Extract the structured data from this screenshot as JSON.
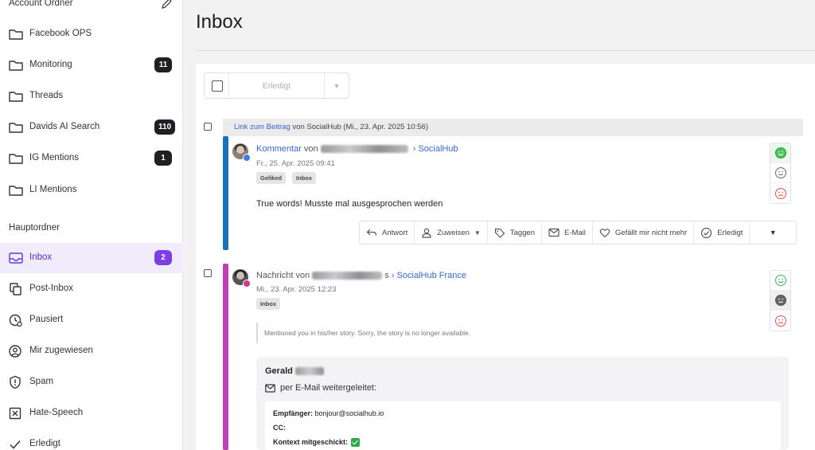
{
  "sidebar": {
    "account_folders_heading": "Account Ordner",
    "account_folders": [
      {
        "label": "Facebook OPS",
        "icon": "folder-icon",
        "count": ""
      },
      {
        "label": "Monitoring",
        "icon": "folder-icon",
        "count": "11"
      },
      {
        "label": "Threads",
        "icon": "folder-icon",
        "count": ""
      },
      {
        "label": "Davids AI Search",
        "icon": "folder-icon",
        "count": "110"
      },
      {
        "label": "IG Mentions",
        "icon": "folder-icon",
        "count": "1"
      },
      {
        "label": "LI Mentions",
        "icon": "folder-icon",
        "count": ""
      }
    ],
    "main_folders_heading": "Hauptordner",
    "main_folders": [
      {
        "label": "Inbox",
        "icon": "inbox-icon",
        "count": "2",
        "active": true
      },
      {
        "label": "Post-Inbox",
        "icon": "copy-icon",
        "count": ""
      },
      {
        "label": "Pausiert",
        "icon": "clock-icon",
        "count": ""
      },
      {
        "label": "Mir zugewiesen",
        "icon": "user-circle-icon",
        "count": ""
      },
      {
        "label": "Spam",
        "icon": "shield-alert-icon",
        "count": ""
      },
      {
        "label": "Hate-Speech",
        "icon": "x-square-icon",
        "count": ""
      },
      {
        "label": "Erledigt",
        "icon": "check-icon",
        "count": ""
      }
    ]
  },
  "main": {
    "title": "Inbox",
    "toolbar": {
      "done_label": "Erledigt"
    }
  },
  "post_bar": {
    "link_text": "Link zum Beitrag",
    "rest_text": "von SocialHub (Mi., 23. Apr. 2025 10:56)"
  },
  "messages": [
    {
      "kind": "Kommentar",
      "from_word": "von",
      "target": "SocialHub",
      "date": "Fr., 25. Apr. 2025 09:41",
      "tags": [
        "Geliked",
        "Inbox"
      ],
      "text": "True words! Musste mal ausgesprochen werden",
      "accent_color": "#1a73b8",
      "network_color": "#3b82d6",
      "sentiment": "positive"
    },
    {
      "kind": "Nachricht",
      "from_word": "von",
      "name_suffix": "s",
      "target": "SocialHub France",
      "date": "Mi., 23. Apr. 2025 12:23",
      "tags": [
        "Inbox"
      ],
      "quote": "Mentioned you in his/her story. Sorry, the story is no longer available.",
      "accent_color": "#c13fb4",
      "network_color": "#d6338a",
      "sentiment": "neutral"
    }
  ],
  "actions": [
    {
      "label": "Antwort",
      "icon": "reply-icon"
    },
    {
      "label": "Zuweisen",
      "icon": "user-icon"
    },
    {
      "label": "Taggen",
      "icon": "tag-icon"
    },
    {
      "label": "E-Mail",
      "icon": "mail-icon"
    },
    {
      "label": "Gefällt mir nicht mehr",
      "icon": "heart-icon"
    },
    {
      "label": "Erledigt",
      "icon": "check-circle-icon"
    }
  ],
  "forward": {
    "name": "Gerald",
    "via": "per E-Mail weitergeleitet:",
    "recipient_label": "Empfänger:",
    "recipient_value": "bonjour@socialhub.io",
    "cc_label": "CC:",
    "context_label": "Kontext mitgeschickt:"
  }
}
